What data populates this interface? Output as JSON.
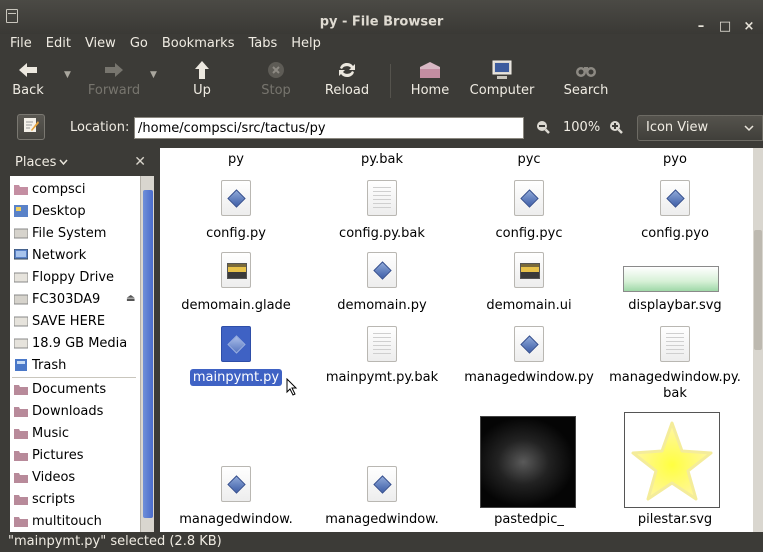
{
  "window": {
    "title": "py - File Browser",
    "controls": [
      "–",
      "□",
      "×"
    ]
  },
  "menu": [
    "File",
    "Edit",
    "View",
    "Go",
    "Bookmarks",
    "Tabs",
    "Help"
  ],
  "toolbar": {
    "back": "Back",
    "forward": "Forward",
    "up": "Up",
    "stop": "Stop",
    "reload": "Reload",
    "home": "Home",
    "computer": "Computer",
    "search": "Search"
  },
  "location": {
    "label": "Location:",
    "path": "/home/compsci/src/tactus/py",
    "zoom": "100%",
    "view_mode": "Icon View"
  },
  "sidebar": {
    "header": "Places",
    "items": [
      "compsci",
      "Desktop",
      "File System",
      "Network",
      "Floppy Drive",
      "FC303DA9",
      "SAVE HERE",
      "18.9 GB Media",
      "Trash"
    ],
    "bookmarks": [
      "Documents",
      "Downloads",
      "Music",
      "Pictures",
      "Videos",
      "scripts",
      "multitouch"
    ]
  },
  "files": {
    "top_row": [
      "py",
      "py.bak",
      "pyc",
      "pyo"
    ],
    "items": [
      {
        "name": "config.py",
        "icon": "python-file-icon"
      },
      {
        "name": "config.py.bak",
        "icon": "text-file-icon"
      },
      {
        "name": "config.pyc",
        "icon": "python-file-icon"
      },
      {
        "name": "config.pyo",
        "icon": "python-file-icon"
      },
      {
        "name": "demomain.glade",
        "icon": "glade-file-icon"
      },
      {
        "name": "demomain.py",
        "icon": "python-file-icon"
      },
      {
        "name": "demomain.ui",
        "icon": "glade-file-icon"
      },
      {
        "name": "displaybar.svg",
        "icon": "svg-thumbnail"
      },
      {
        "name": "mainpymt.py",
        "icon": "python-file-icon"
      },
      {
        "name": "mainpymt.py.bak",
        "icon": "text-file-icon"
      },
      {
        "name": "managedwindow.py",
        "icon": "python-file-icon"
      },
      {
        "name": "managedwindow.py.",
        "name2": "bak",
        "icon": "text-file-icon"
      },
      {
        "name": "managedwindow.",
        "icon": "python-file-icon"
      },
      {
        "name": "managedwindow.",
        "icon": "python-file-icon"
      },
      {
        "name": "pastedpic_",
        "icon": "image-thumbnail"
      },
      {
        "name": "pilestar.svg",
        "icon": "svg-thumbnail"
      }
    ]
  },
  "status": "\"mainpymt.py\" selected (2.8 KB)"
}
